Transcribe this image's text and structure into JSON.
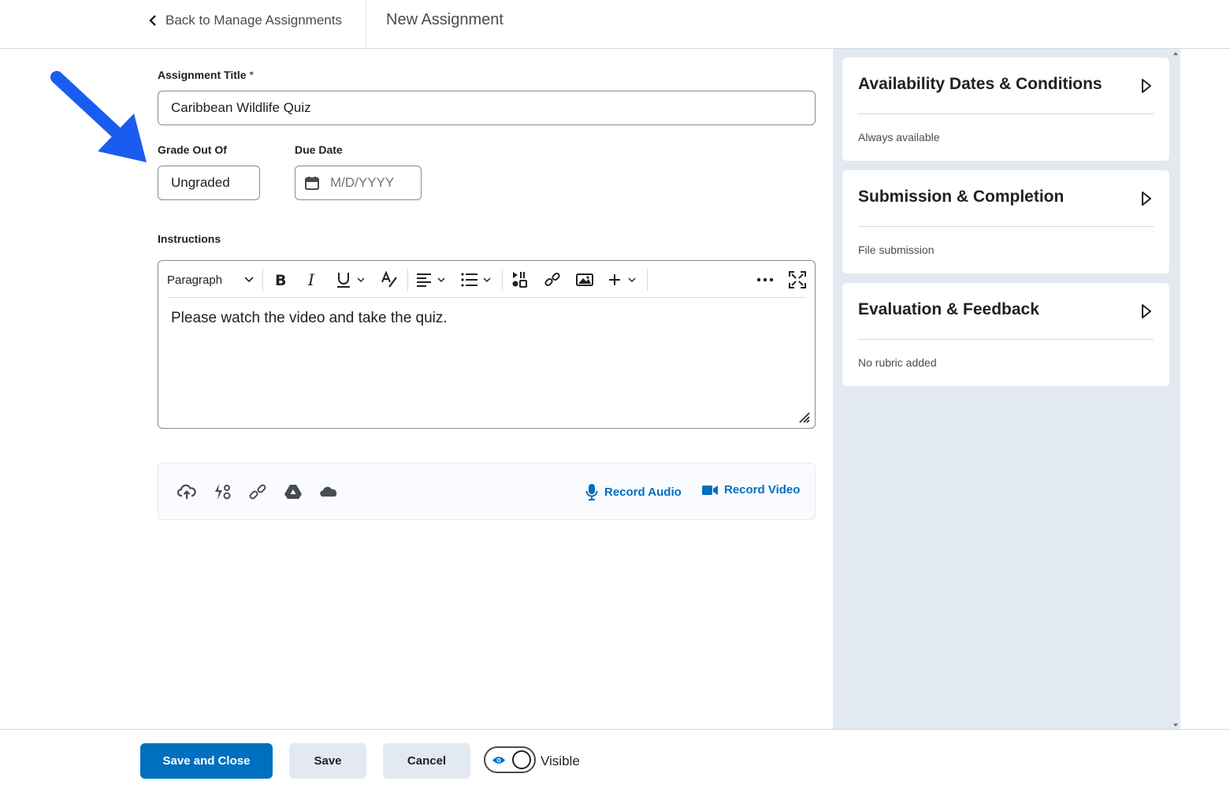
{
  "header": {
    "back_label": "Back to Manage Assignments",
    "page_title": "New Assignment"
  },
  "form": {
    "title_label": "Assignment Title",
    "title_required_mark": "*",
    "title_value": "Caribbean Wildlife Quiz",
    "grade_label": "Grade Out Of",
    "grade_value": "Ungraded",
    "due_label": "Due Date",
    "due_placeholder": "M/D/YYYY",
    "instructions_label": "Instructions",
    "paragraph_style": "Paragraph",
    "instructions_text": "Please watch the video and take the quiz."
  },
  "attachments": {
    "icons": [
      "upload-icon",
      "quicklink-icon",
      "link-icon",
      "google-drive-icon",
      "onedrive-icon"
    ],
    "record_audio_label": "Record Audio",
    "record_video_label": "Record Video"
  },
  "sidebar": {
    "cards": [
      {
        "title": "Availability Dates & Conditions",
        "subtitle": "Always available"
      },
      {
        "title": "Submission & Completion",
        "subtitle": "File submission"
      },
      {
        "title": "Evaluation & Feedback",
        "subtitle": "No rubric added"
      }
    ]
  },
  "footer": {
    "save_close_label": "Save and Close",
    "save_label": "Save",
    "cancel_label": "Cancel",
    "visibility_label": "Visible"
  },
  "colors": {
    "primary": "#006fbf",
    "annotation_arrow": "#1a5cf0",
    "panel_bg": "#e3e9f1"
  }
}
